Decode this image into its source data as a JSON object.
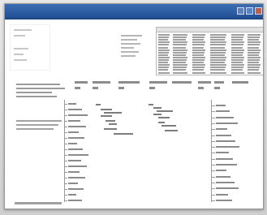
{
  "window": {
    "title": "",
    "controls": [
      "minimize-icon",
      "maximize-icon",
      "close-icon"
    ]
  },
  "colors": {
    "titlebar": "#1f4d92",
    "background": "#ffffff",
    "text": "#8b8b8b"
  }
}
